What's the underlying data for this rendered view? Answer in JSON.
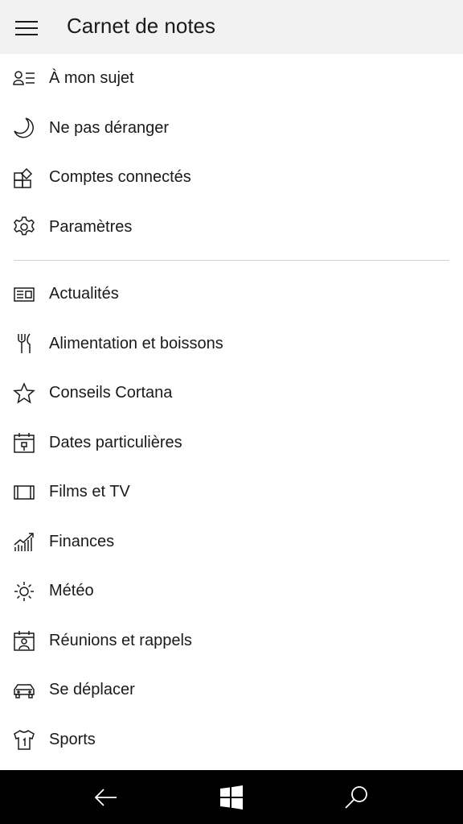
{
  "header": {
    "title": "Carnet de notes",
    "menu_icon": "hamburger-icon"
  },
  "section1": [
    {
      "label": "À mon sujet",
      "icon": "person-list-icon"
    },
    {
      "label": "Ne pas déranger",
      "icon": "moon-icon"
    },
    {
      "label": "Comptes connectés",
      "icon": "connected-accounts-icon"
    },
    {
      "label": "Paramètres",
      "icon": "gear-icon"
    }
  ],
  "section2": [
    {
      "label": "Actualités",
      "icon": "newspaper-icon"
    },
    {
      "label": "Alimentation et boissons",
      "icon": "fork-knife-icon"
    },
    {
      "label": "Conseils Cortana",
      "icon": "star-icon"
    },
    {
      "label": "Dates particulières",
      "icon": "calendar-gift-icon"
    },
    {
      "label": "Films et TV",
      "icon": "film-icon"
    },
    {
      "label": "Finances",
      "icon": "finance-chart-icon"
    },
    {
      "label": "Météo",
      "icon": "sun-icon"
    },
    {
      "label": "Réunions et rappels",
      "icon": "calendar-person-icon"
    },
    {
      "label": "Se déplacer",
      "icon": "car-icon"
    },
    {
      "label": "Sports",
      "icon": "jersey-icon"
    }
  ],
  "taskbar": {
    "back_icon": "back-arrow-icon",
    "home_icon": "windows-logo-icon",
    "search_icon": "search-icon"
  }
}
